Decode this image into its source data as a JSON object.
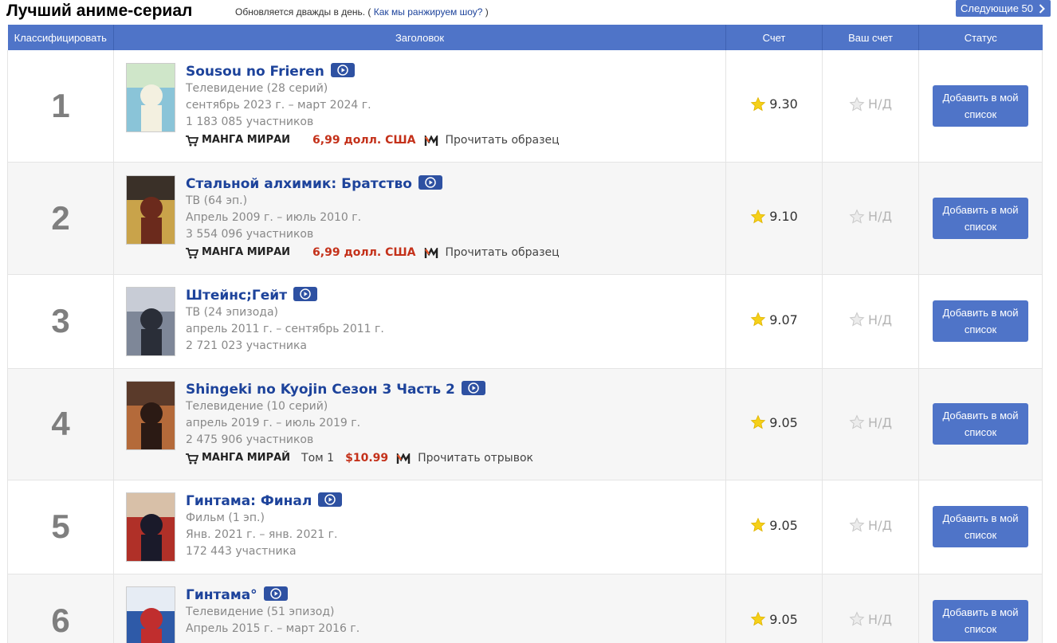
{
  "header": {
    "title": "Лучший аниме-сериал",
    "update_text": "Обновляется дважды в день.",
    "paren_open": "(",
    "rank_link": "Как мы ранжируем шоу?",
    "paren_close": ")",
    "next_button": "Следующие 50",
    "next_icon": "chevron-right-icon"
  },
  "columns": {
    "rank": "Классифицировать",
    "title": "Заголовок",
    "score": "Счет",
    "your_score": "Ваш счет",
    "status": "Статус"
  },
  "colors": {
    "accent": "#4f74c8",
    "link": "#1d439b",
    "price": "#c4311a",
    "star": "#f5d019"
  },
  "rows": [
    {
      "rank": "1",
      "title": "Sousou no Frieren",
      "type": "Телевидение (28 серий)",
      "dates": "сентябрь 2023 г. – март 2024 г.",
      "members": "1 183 085 участников",
      "manga": {
        "brand": "МАНГА МИРАИ",
        "volume": "",
        "price": "6,99 долл. США",
        "sample": "Прочитать образец"
      },
      "score": "9.30",
      "your_score": "Н/Д",
      "status_button": "Добавить в мой список"
    },
    {
      "rank": "2",
      "title": "Стальной алхимик: Братство",
      "type": "ТВ (64 эп.)",
      "dates": "Апрель 2009 г. – июль 2010 г.",
      "members": "3 554 096 участников",
      "manga": {
        "brand": "МАНГА МИРАИ",
        "volume": "",
        "price": "6,99 долл. США",
        "sample": "Прочитать образец"
      },
      "score": "9.10",
      "your_score": "Н/Д",
      "status_button": "Добавить в мой список"
    },
    {
      "rank": "3",
      "title": "Штейнс;Гейт",
      "type": "ТВ (24 эпизода)",
      "dates": "апрель 2011 г. – сентябрь 2011 г.",
      "members": "2 721 023 участника",
      "manga": null,
      "score": "9.07",
      "your_score": "Н/Д",
      "status_button": "Добавить в мой список"
    },
    {
      "rank": "4",
      "title": "Shingeki no Kyojin Сезон 3 Часть 2",
      "type": "Телевидение (10 серий)",
      "dates": "апрель 2019 г. – июль 2019 г.",
      "members": "2 475 906 участников",
      "manga": {
        "brand": "МАНГА МИРАЙ",
        "volume": "Том 1",
        "price": "$10.99",
        "sample": "Прочитать отрывок"
      },
      "score": "9.05",
      "your_score": "Н/Д",
      "status_button": "Добавить в мой список"
    },
    {
      "rank": "5",
      "title": "Гинтама: Финал",
      "type": "Фильм (1 эп.)",
      "dates": "Янв. 2021 г. – янв. 2021 г.",
      "members": "172 443 участника",
      "manga": null,
      "score": "9.05",
      "your_score": "Н/Д",
      "status_button": "Добавить в мой список"
    },
    {
      "rank": "6",
      "title": "Гинтама°",
      "type": "Телевидение (51 эпизод)",
      "dates": "Апрель 2015 г. – март 2016 г.",
      "members": "",
      "manga": null,
      "score": "9.05",
      "your_score": "Н/Д",
      "status_button": "Добавить в мой список"
    }
  ]
}
